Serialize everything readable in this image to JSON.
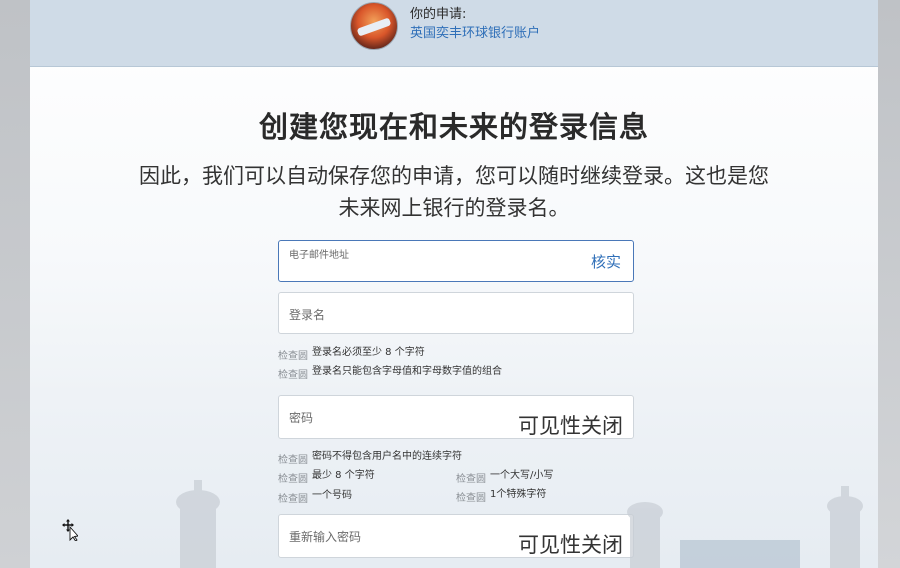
{
  "header": {
    "label": "你的申请:",
    "product": "英国奕丰环球银行账户"
  },
  "main": {
    "title": "创建您现在和未来的登录信息",
    "subtitle": "因此，我们可以自动保存您的申请，您可以随时继续登录。这也是您未来网上银行的登录名。"
  },
  "form": {
    "email": {
      "label": "电子邮件地址",
      "action": "核实"
    },
    "username": {
      "placeholder": "登录名"
    },
    "password": {
      "placeholder": "密码",
      "toggle": "可见性关闭"
    },
    "confirm": {
      "placeholder": "重新输入密码",
      "toggle": "可见性关闭"
    }
  },
  "rules": {
    "check_label": "检查圆",
    "username": [
      "登录名必须至少 8 个字符",
      "登录名只能包含字母值和字母数字值的组合"
    ],
    "password": {
      "full": "密码不得包含用户名中的连续字符",
      "left": [
        "最少 8 个字符",
        "一个号码"
      ],
      "right": [
        "一个大写/小写",
        "1个特殊字符"
      ]
    }
  },
  "icons": {
    "cursor": "move-cursor-icon",
    "avatar": "product-image"
  },
  "colors": {
    "header_bg": "#cfdbe7",
    "link": "#2f6fb8",
    "active_border": "#4a78b8"
  }
}
